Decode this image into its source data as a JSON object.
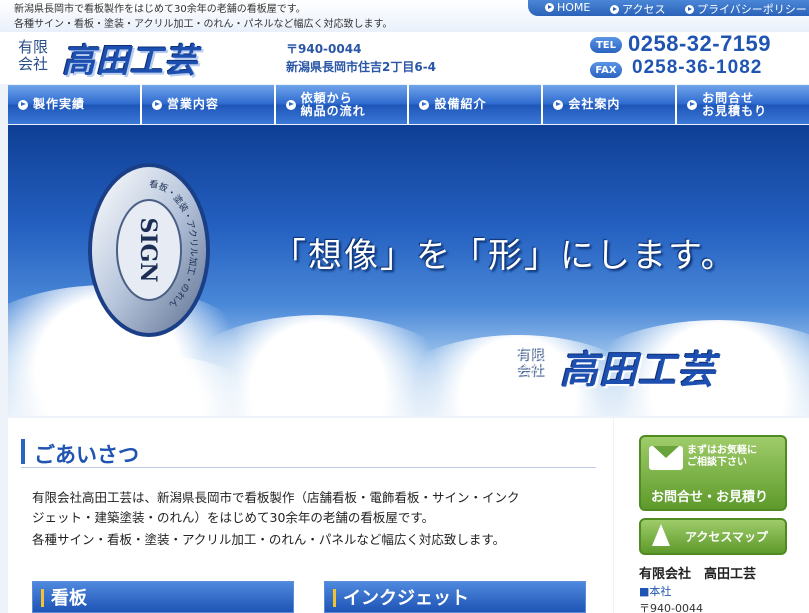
{
  "header": {
    "tagline_1": "新潟県長岡市で看板製作をはじめて30余年の老舗の看板屋です。",
    "tagline_2": "各種サイン・看板・塗装・アクリル加工・のれん・パネルなど幅広く対応致します。",
    "top_nav": [
      {
        "label": "HOME"
      },
      {
        "label": "アクセス"
      },
      {
        "label": "プライバシーポリシー"
      }
    ],
    "company_type_1": "有限",
    "company_type_2": "会社",
    "company_name": "高田工芸",
    "zip": "〒940-0044",
    "address": "新潟県長岡市住吉2丁目6-4",
    "tel_tag": "TEL",
    "tel": "0258-32-7159",
    "fax_tag": "FAX",
    "fax": "0258-36-1082"
  },
  "main_nav": [
    {
      "label": "製作実績"
    },
    {
      "label": "営業内容"
    },
    {
      "label": "依頼から\n納品の流れ"
    },
    {
      "label": "設備紹介"
    },
    {
      "label": "会社案内"
    },
    {
      "label": "お問合せ\nお見積もり"
    }
  ],
  "hero": {
    "catchphrase": "「想像」を「形」にします。",
    "disc_center_text": "SIGN",
    "disc_ring_text": "看板・塗装・アクリル加工・のれん",
    "company_type_1": "有限",
    "company_type_2": "会社",
    "company_name": "高田工芸"
  },
  "greeting": {
    "title": "ごあいさつ",
    "line_1": "有限会社高田工芸は、新潟県長岡市で看板製作（店舗看板・電飾看板・サイン・インク",
    "line_2": "ジェット・建築塗装・のれん）をはじめて30余年の老舗の看板屋です。",
    "line_3": "各種サイン・看板・塗装・アクリル加工・のれん・パネルなど幅広く対応致します。"
  },
  "sections": [
    {
      "label": "看板"
    },
    {
      "label": "インクジェット"
    }
  ],
  "sidebar": {
    "contact_small": "まずはお気軽に\nご相談下さい",
    "contact_big": "お問合せ・お見積り",
    "access_label": "アクセスマップ",
    "company": "有限会社　高田工芸",
    "hq": "■本社",
    "zip": "〒940-0044"
  },
  "colors": {
    "accent_blue": "#1f54b3",
    "nav_blue": "#2f6bd0",
    "green_button": "#6aa33a"
  }
}
